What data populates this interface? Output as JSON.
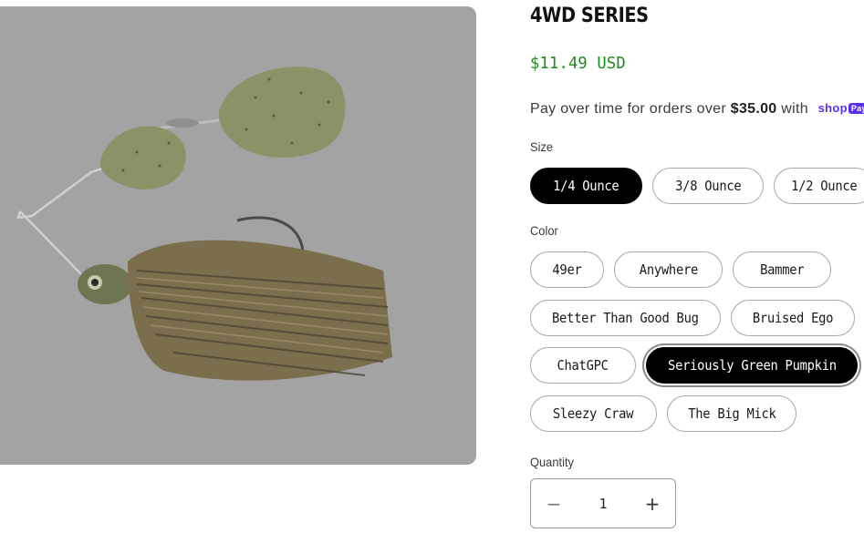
{
  "product": {
    "title": "4WD SERIES",
    "price": "$11.49 USD",
    "installments": {
      "prefix": "Pay over time for orders over ",
      "amount": "$35.00",
      "suffix": " with ",
      "brand": "shop",
      "brand_badge": "Pay"
    }
  },
  "size": {
    "label": "Size",
    "selected": "1/4 Ounce",
    "options": [
      "1/4 Ounce",
      "3/8 Ounce",
      "1/2 Ounce"
    ]
  },
  "color": {
    "label": "Color",
    "selected": "Seriously Green Pumpkin",
    "options": [
      "49er",
      "Anywhere",
      "Bammer",
      "Better Than Good Bug",
      "Bruised Ego",
      "ChatGPC",
      "Seriously Green Pumpkin",
      "Sleezy Craw",
      "The Big Mick"
    ]
  },
  "quantity": {
    "label": "Quantity",
    "value": "1",
    "minus": "−",
    "plus": "+"
  },
  "media": {
    "icon": "spinnerbait-lure-image",
    "background_color": "#a3a3a3"
  },
  "colors": {
    "price": "#1d8a1d",
    "selected_pill": "#000000",
    "shop_pay": "#5a31f4"
  }
}
